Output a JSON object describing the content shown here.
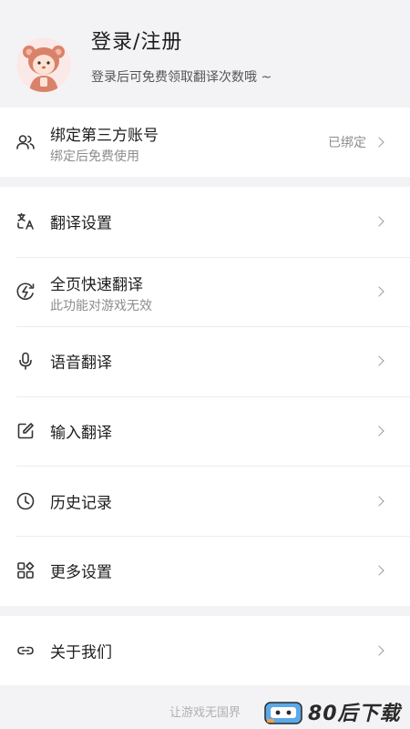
{
  "header": {
    "title": "登录/注册",
    "subtitle": "登录后可免费领取翻译次数哦 ~"
  },
  "bind": {
    "label": "绑定第三方账号",
    "sub": "绑定后免费使用",
    "status": "已绑定",
    "icon": "users-icon"
  },
  "menu": [
    {
      "label": "翻译设置",
      "icon": "translate-icon"
    },
    {
      "label": "全页快速翻译",
      "sub": "此功能对游戏无效",
      "icon": "fast-translate-icon"
    },
    {
      "label": "语音翻译",
      "icon": "microphone-icon"
    },
    {
      "label": "输入翻译",
      "icon": "edit-icon"
    },
    {
      "label": "历史记录",
      "icon": "clock-icon"
    },
    {
      "label": "更多设置",
      "icon": "grid-icon"
    }
  ],
  "about": {
    "label": "关于我们",
    "icon": "link-icon"
  },
  "footer": {
    "slogan": "让游戏无国界",
    "watermark": "80后下载"
  }
}
